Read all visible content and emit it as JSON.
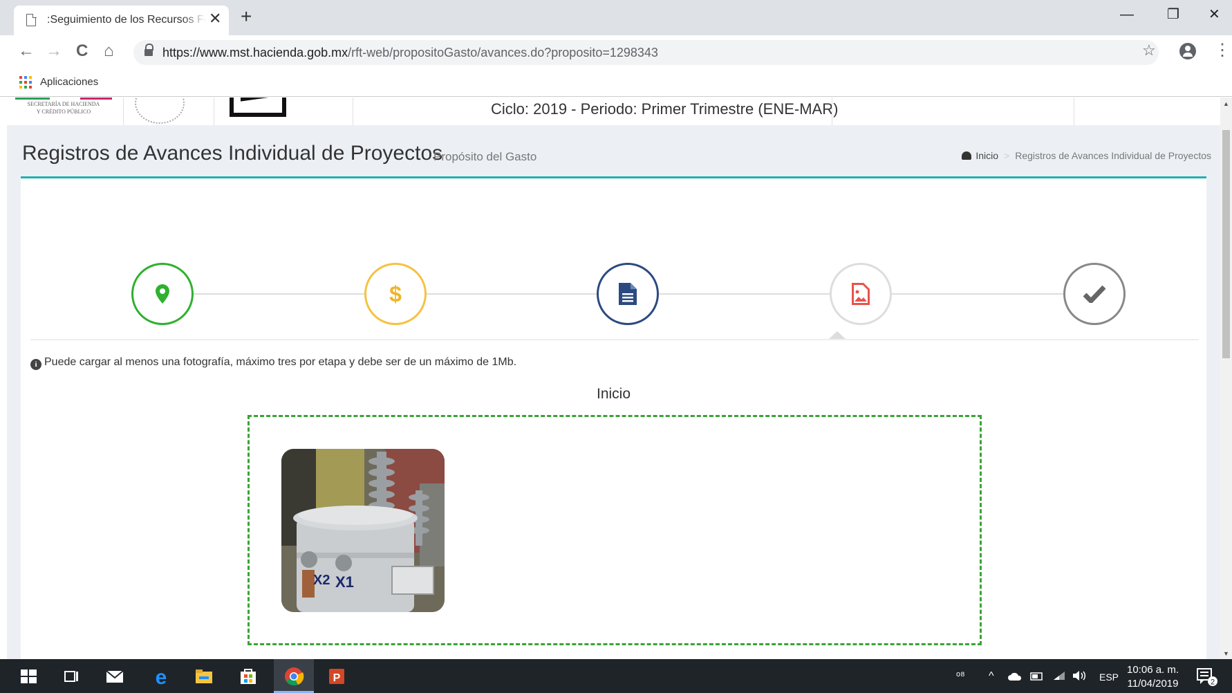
{
  "browser": {
    "tab_title": ":Seguimiento de los Recursos Fe",
    "tab_close": "✕",
    "new_tab": "+",
    "url_host": "https://www.mst.hacienda.gob.mx",
    "url_path": "/rft-web/propositoGasto/avances.do?proposito=1298343",
    "bookmarks_apps_label": "Aplicaciones",
    "controls": {
      "minimize": "—",
      "restore": "❐",
      "close": "✕"
    },
    "nav": {
      "back": "←",
      "forward": "→",
      "reload": "C",
      "home": "⌂",
      "star": "☆",
      "menu": "⋮"
    }
  },
  "site_header": {
    "logo_text": "SECRETARÍA DE HACIENDA\nY CRÉDITO PÚBLICO",
    "cycle_text": "Ciclo: 2019 - Periodo: Primer Trimestre (ENE-MAR)"
  },
  "content_header": {
    "title": "Registros de Avances Individual de Proyectos",
    "subtitle": "Propósito del Gasto",
    "breadcrumb": {
      "home": "Inicio",
      "separator": ">",
      "current": "Registros de Avances Individual de Proyectos"
    }
  },
  "wizard": {
    "steps": [
      {
        "icon": "map-marker-icon",
        "color": "#2fb02f",
        "state": "done"
      },
      {
        "icon": "dollar-icon",
        "color": "#f5c242",
        "state": "done"
      },
      {
        "icon": "document-icon",
        "color": "#2c4a80",
        "state": "done"
      },
      {
        "icon": "image-file-icon",
        "color": "#e8524a",
        "state": "current"
      },
      {
        "icon": "check-icon",
        "color": "#777777",
        "state": "pending"
      }
    ]
  },
  "upload": {
    "info_text": "Puede cargar al menos una fotografía, máximo tres por etapa y debe ser de un máximo de 1Mb.",
    "stage_title": "Inicio",
    "photos": [
      {
        "subject": "transformer-photo",
        "labels": [
          "X2",
          "X1"
        ]
      }
    ]
  },
  "taskbar": {
    "tray_lang": "ESP",
    "time": "10:06 a. m.",
    "date": "11/04/2019",
    "notifications": "2"
  },
  "colors": {
    "accent": "#1fb0b0",
    "dropzone_border": "#3aa335",
    "content_bg": "#ecf0f5"
  }
}
